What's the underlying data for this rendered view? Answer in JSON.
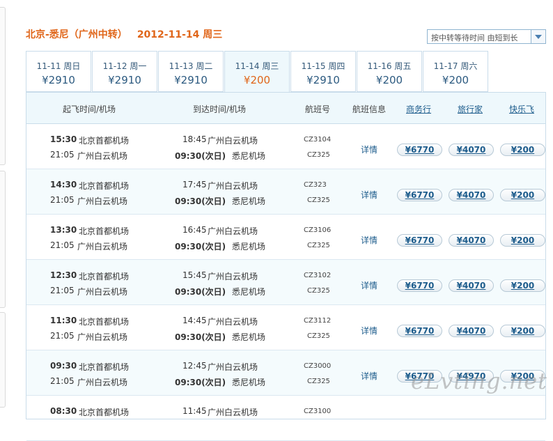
{
  "route_title": {
    "route": "北京-悉尼（广州中转）",
    "date": "2012-11-14 周三"
  },
  "sort_select": {
    "value": "按中转等待时间 由短到长"
  },
  "date_tabs": [
    {
      "date": "11-11 周日",
      "price": "¥2910"
    },
    {
      "date": "11-12 周一",
      "price": "¥2910"
    },
    {
      "date": "11-13 周二",
      "price": "¥2910"
    },
    {
      "date": "11-14 周三",
      "price": "¥200",
      "active": true
    },
    {
      "date": "11-15 周四",
      "price": "¥2910"
    },
    {
      "date": "11-16 周五",
      "price": "¥200"
    },
    {
      "date": "11-17 周六",
      "price": "¥200"
    }
  ],
  "table_header": {
    "depart": "起飞时间/机场",
    "arrive": "到达时间/机场",
    "flight_no": "航班号",
    "flight_info": "航班信息",
    "agency1": "商务行",
    "agency2": "旅行家",
    "agency3": "快乐飞"
  },
  "flights": [
    {
      "dep1_time": "15:30",
      "dep1_airport": "北京首都机场",
      "dep2_time": "21:05",
      "dep2_airport": "广州白云机场",
      "arr1_time": "18:45",
      "arr1_airport": "广州白云机场",
      "arr2_time": "09:30(次日)",
      "arr2_airport": "悉尼机场",
      "fn1": "CZ3104",
      "fn2": "CZ325",
      "detail": "详情",
      "p1": "¥6770",
      "p2": "¥4070",
      "p3": "¥200"
    },
    {
      "dep1_time": "14:30",
      "dep1_airport": "北京首都机场",
      "dep2_time": "21:05",
      "dep2_airport": "广州白云机场",
      "arr1_time": "17:45",
      "arr1_airport": "广州白云机场",
      "arr2_time": "09:30(次日)",
      "arr2_airport": "悉尼机场",
      "fn1": "CZ323",
      "fn2": "CZ325",
      "detail": "详情",
      "p1": "¥6770",
      "p2": "¥4070",
      "p3": "¥200"
    },
    {
      "dep1_time": "13:30",
      "dep1_airport": "北京首都机场",
      "dep2_time": "21:05",
      "dep2_airport": "广州白云机场",
      "arr1_time": "16:45",
      "arr1_airport": "广州白云机场",
      "arr2_time": "09:30(次日)",
      "arr2_airport": "悉尼机场",
      "fn1": "CZ3106",
      "fn2": "CZ325",
      "detail": "详情",
      "p1": "¥6770",
      "p2": "¥4070",
      "p3": "¥200"
    },
    {
      "dep1_time": "12:30",
      "dep1_airport": "北京首都机场",
      "dep2_time": "21:05",
      "dep2_airport": "广州白云机场",
      "arr1_time": "15:45",
      "arr1_airport": "广州白云机场",
      "arr2_time": "09:30(次日)",
      "arr2_airport": "悉尼机场",
      "fn1": "CZ3102",
      "fn2": "CZ325",
      "detail": "详情",
      "p1": "¥6770",
      "p2": "¥4070",
      "p3": "¥200"
    },
    {
      "dep1_time": "11:30",
      "dep1_airport": "北京首都机场",
      "dep2_time": "21:05",
      "dep2_airport": "广州白云机场",
      "arr1_time": "14:45",
      "arr1_airport": "广州白云机场",
      "arr2_time": "09:30(次日)",
      "arr2_airport": "悉尼机场",
      "fn1": "CZ3112",
      "fn2": "CZ325",
      "detail": "详情",
      "p1": "¥6770",
      "p2": "¥4070",
      "p3": "¥200"
    },
    {
      "dep1_time": "09:30",
      "dep1_airport": "北京首都机场",
      "dep2_time": "21:05",
      "dep2_airport": "广州白云机场",
      "arr1_time": "12:45",
      "arr1_airport": "广州白云机场",
      "arr2_time": "09:30(次日)",
      "arr2_airport": "悉尼机场",
      "fn1": "CZ3000",
      "fn2": "CZ325",
      "detail": "详情",
      "p1": "¥6770",
      "p2": "¥4970",
      "p3": "¥200"
    },
    {
      "dep1_time": "08:30",
      "dep1_airport": "北京首都机场",
      "dep2_time": "",
      "dep2_airport": "",
      "arr1_time": "11:45",
      "arr1_airport": "广州白云机场",
      "arr2_time": "",
      "arr2_airport": "",
      "fn1": "CZ3100",
      "fn2": "",
      "detail": "",
      "p1": "",
      "p2": "",
      "p3": ""
    }
  ],
  "watermark": "eLvting.net"
}
